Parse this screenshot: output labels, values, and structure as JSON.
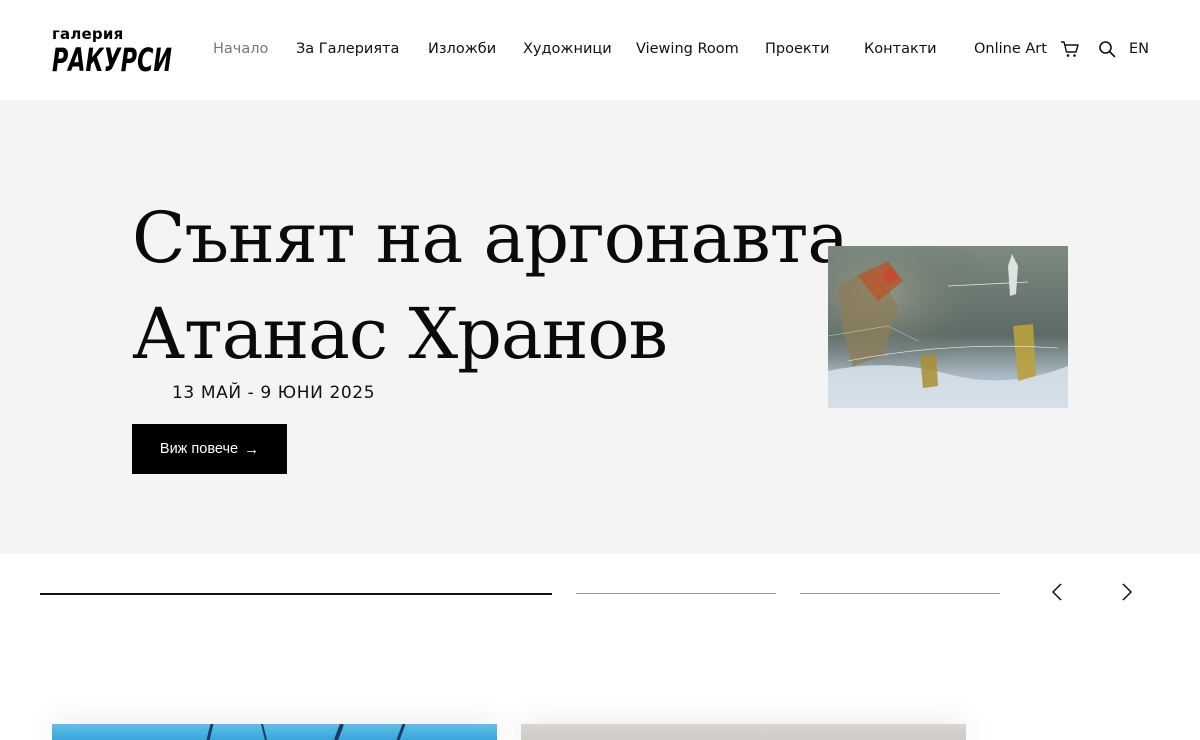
{
  "logo": {
    "top": "галерия",
    "main": "РАКУРСИ"
  },
  "nav": {
    "items": [
      {
        "label": "Начало",
        "active": true
      },
      {
        "label": "За Галерията",
        "active": false
      },
      {
        "label": "Изложби",
        "active": false
      },
      {
        "label": "Художници",
        "active": false
      },
      {
        "label": "Viewing Room",
        "active": false
      },
      {
        "label": "Проекти",
        "active": false
      },
      {
        "label": "Контакти",
        "active": false
      },
      {
        "label": "Online Art",
        "active": false
      }
    ],
    "cart_icon": "cart-icon",
    "search_icon": "search-icon",
    "language": "EN"
  },
  "hero": {
    "title_line1": "Сънят на аргонавта",
    "title_line2": "Атанас Хранов",
    "dates": "13 МАЙ - 9 ЮНИ 2025",
    "button_label": "Виж повече",
    "button_arrow": "→",
    "background": "#f4f4f4"
  },
  "slider": {
    "slides": 3,
    "active_index": 0,
    "prev_icon": "chevron-left-icon",
    "next_icon": "chevron-right-icon"
  },
  "colors": {
    "accent": "#000000",
    "text": "#111111",
    "muted_nav": "#777777"
  }
}
